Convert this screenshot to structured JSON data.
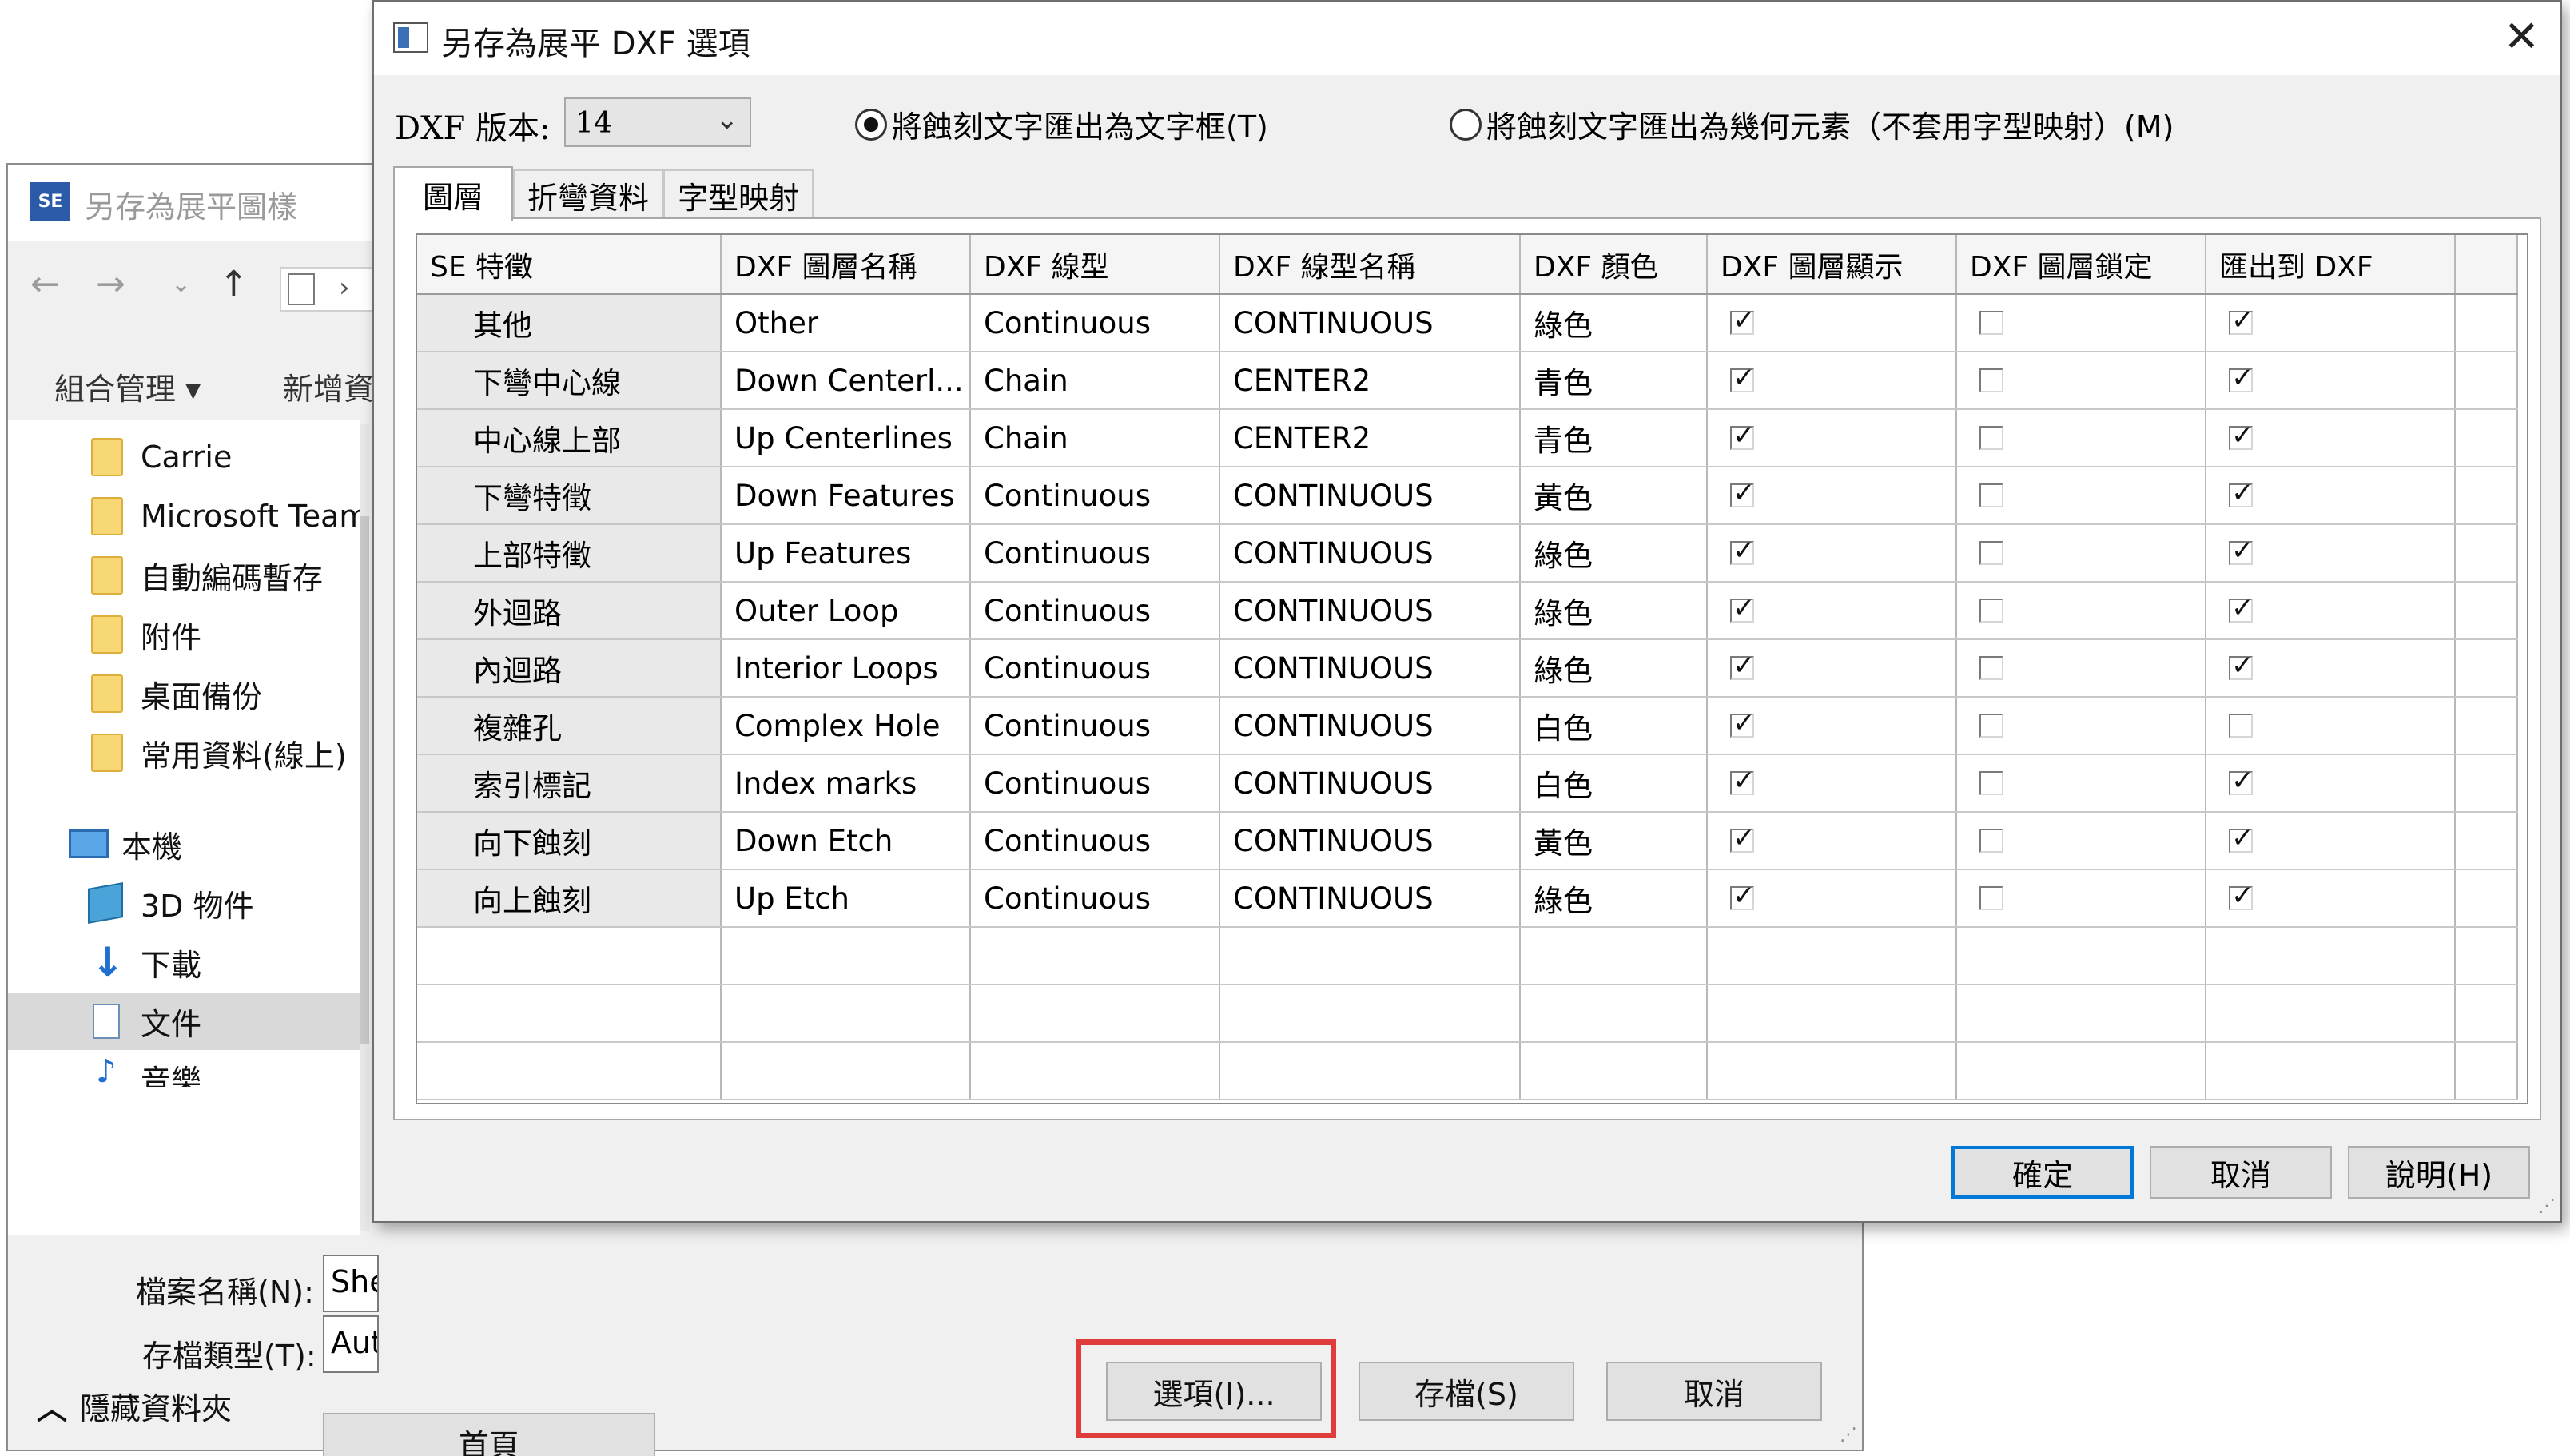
{
  "background_window": {
    "title": "另存為展平圖樣",
    "logo_text": "SE",
    "nav": {
      "back": "←",
      "forward": "→",
      "recent": "⌄",
      "up": "↑",
      "chevron": "›"
    },
    "commands": [
      "組合管理 ▾",
      "新增資"
    ],
    "tree": [
      {
        "label": "Carrie",
        "icon": "folder-icon"
      },
      {
        "label": "Microsoft Team",
        "icon": "folder-icon"
      },
      {
        "label": "自動編碼暫存",
        "icon": "folder-icon"
      },
      {
        "label": "附件",
        "icon": "folder-icon"
      },
      {
        "label": "桌面備份",
        "icon": "folder-icon"
      },
      {
        "label": "常用資料(線上)",
        "icon": "folder-icon"
      },
      {
        "label": "本機",
        "icon": "computer-icon"
      },
      {
        "label": "3D 物件",
        "icon": "3d-objects-icon"
      },
      {
        "label": "下載",
        "icon": "download-icon"
      },
      {
        "label": "文件",
        "icon": "documents-icon"
      },
      {
        "label": "音樂",
        "icon": "music-icon"
      }
    ],
    "filename_label": "檔案名稱(N):",
    "filename_value": "She",
    "filetype_label": "存檔類型(T):",
    "filetype_value": "Aut",
    "home_button": "首頁",
    "hide_folders": "隱藏資料夾",
    "options_button": "選項(I)...",
    "save_button": "存檔(S)",
    "cancel_button": "取消"
  },
  "dialog": {
    "title": "另存為展平 DXF 選項",
    "close": "✕",
    "version_label": "DXF 版本:",
    "version_value": "14",
    "radio_text_box": "將蝕刻文字匯出為文字框(T)",
    "radio_geometry": "將蝕刻文字匯出為幾何元素（不套用字型映射）(M)",
    "tabs": [
      "圖層",
      "折彎資料",
      "字型映射"
    ],
    "columns": [
      "SE 特徵",
      "DXF 圖層名稱",
      "DXF 線型",
      "DXF 線型名稱",
      "DXF 顏色",
      "DXF 圖層顯示",
      "DXF 圖層鎖定",
      "匯出到 DXF"
    ],
    "rows": [
      {
        "feature": "其他",
        "layer": "Other",
        "linetype": "Continuous",
        "linetype_name": "CONTINUOUS",
        "color": "綠色",
        "show": true,
        "lock": false,
        "export": true
      },
      {
        "feature": "下彎中心線",
        "layer": "Down Centerl...",
        "linetype": "Chain",
        "linetype_name": "CENTER2",
        "color": "青色",
        "show": true,
        "lock": false,
        "export": true
      },
      {
        "feature": "中心線上部",
        "layer": "Up Centerlines",
        "linetype": "Chain",
        "linetype_name": "CENTER2",
        "color": "青色",
        "show": true,
        "lock": false,
        "export": true
      },
      {
        "feature": "下彎特徵",
        "layer": "Down Features",
        "linetype": "Continuous",
        "linetype_name": "CONTINUOUS",
        "color": "黃色",
        "show": true,
        "lock": false,
        "export": true
      },
      {
        "feature": "上部特徵",
        "layer": "Up Features",
        "linetype": "Continuous",
        "linetype_name": "CONTINUOUS",
        "color": "綠色",
        "show": true,
        "lock": false,
        "export": true
      },
      {
        "feature": "外迴路",
        "layer": "Outer Loop",
        "linetype": "Continuous",
        "linetype_name": "CONTINUOUS",
        "color": "綠色",
        "show": true,
        "lock": false,
        "export": true
      },
      {
        "feature": "內迴路",
        "layer": "Interior Loops",
        "linetype": "Continuous",
        "linetype_name": "CONTINUOUS",
        "color": "綠色",
        "show": true,
        "lock": false,
        "export": true
      },
      {
        "feature": "複雜孔",
        "layer": "Complex Hole",
        "linetype": "Continuous",
        "linetype_name": "CONTINUOUS",
        "color": "白色",
        "show": true,
        "lock": false,
        "export": false
      },
      {
        "feature": "索引標記",
        "layer": "Index marks",
        "linetype": "Continuous",
        "linetype_name": "CONTINUOUS",
        "color": "白色",
        "show": true,
        "lock": false,
        "export": true
      },
      {
        "feature": "向下蝕刻",
        "layer": "Down Etch",
        "linetype": "Continuous",
        "linetype_name": "CONTINUOUS",
        "color": "黃色",
        "show": true,
        "lock": false,
        "export": true
      },
      {
        "feature": "向上蝕刻",
        "layer": "Up Etch",
        "linetype": "Continuous",
        "linetype_name": "CONTINUOUS",
        "color": "綠色",
        "show": true,
        "lock": false,
        "export": true
      }
    ],
    "ok_button": "確定",
    "cancel_button": "取消",
    "help_button": "說明(H)"
  },
  "colors": {
    "accent": "#0078d7",
    "highlight": "#e03c3c",
    "folder": "#f8d775"
  }
}
